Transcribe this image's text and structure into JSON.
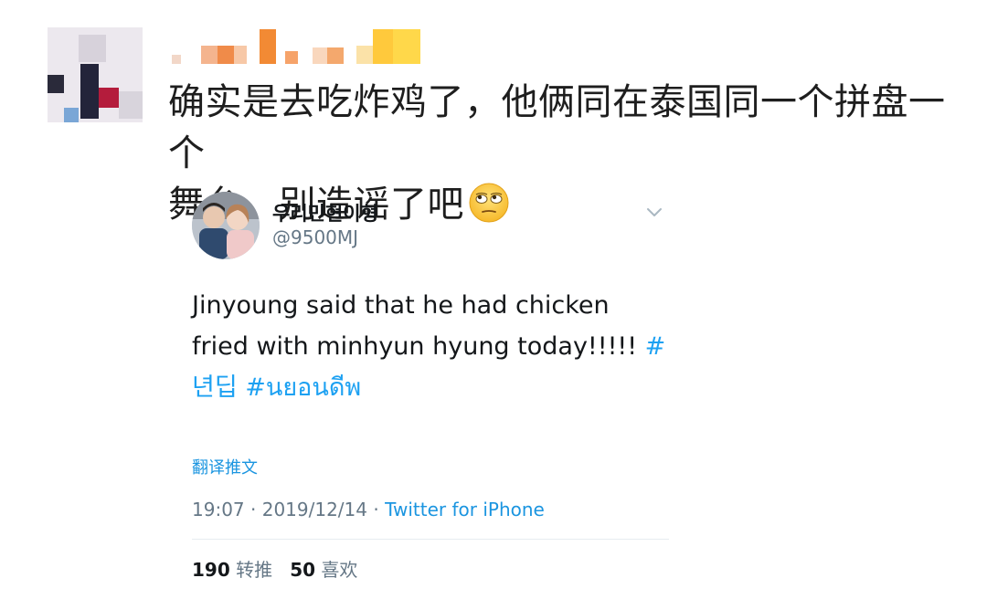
{
  "post": {
    "text_line1": "确实是去吃炸鸡了，他俩同在泰国同一个拼盘一个",
    "text_line2": "舞台，别造谣了吧",
    "emoji": "rolling-eyes-emoji"
  },
  "tweet": {
    "display_name": "우리민현이형",
    "handle": "@9500MJ",
    "body_text": "Jinyoung said that he had chicken fried with minhyun hyung today!!!!! ",
    "hashtag1": "#년딥",
    "hashtag2": "#นยอนดีพ",
    "translate_label": "翻译推文",
    "time": "19:07",
    "date": "2019/12/14",
    "source": "Twitter for iPhone",
    "retweets_count": "190",
    "retweets_label": "转推",
    "likes_count": "50",
    "likes_label": "喜欢"
  },
  "colors": {
    "link": "#1da1f2",
    "meta": "#657786",
    "text": "#14171a"
  }
}
